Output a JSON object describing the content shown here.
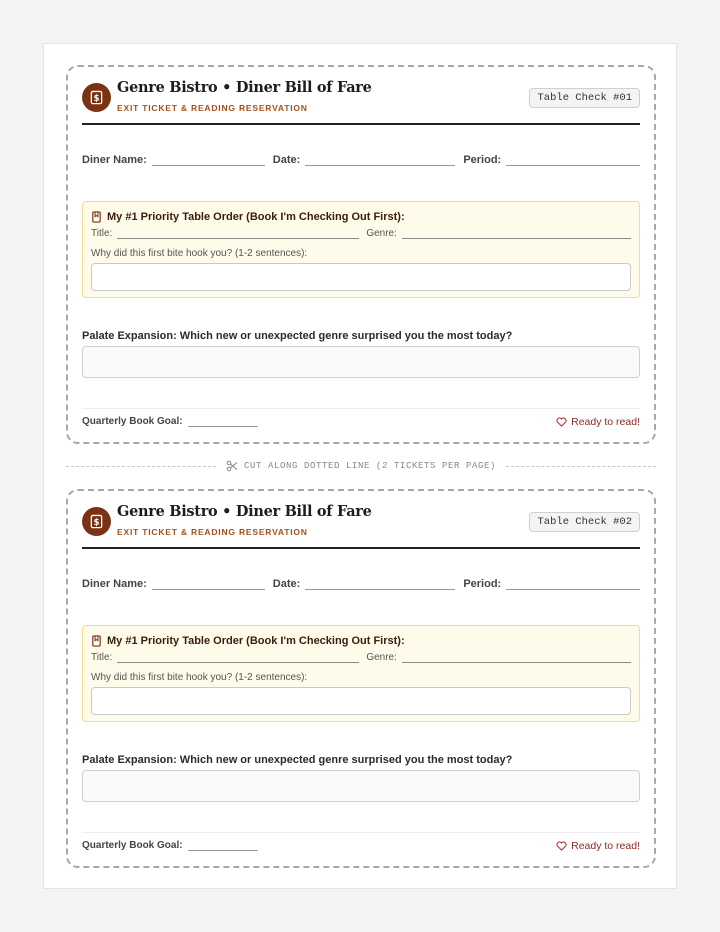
{
  "tickets": [
    {
      "title": "Genre Bistro • Diner Bill of Fare",
      "subtitle": "EXIT TICKET & READING RESERVATION",
      "badge": "Table Check #01",
      "fields": {
        "name": "Diner Name:",
        "date": "Date:",
        "period": "Period:"
      },
      "priority": {
        "heading": "My #1 Priority Table Order (Book I'm Checking Out First):",
        "title_label": "Title:",
        "genre_label": "Genre:",
        "why": "Why did this first bite hook you? (1-2 sentences):"
      },
      "question": "Palate Expansion: Which new or unexpected genre surprised you the most today?",
      "goal_label": "Quarterly Book Goal:",
      "ready": "Ready to read!"
    },
    {
      "title": "Genre Bistro • Diner Bill of Fare",
      "subtitle": "EXIT TICKET & READING RESERVATION",
      "badge": "Table Check #02",
      "fields": {
        "name": "Diner Name:",
        "date": "Date:",
        "period": "Period:"
      },
      "priority": {
        "heading": "My #1 Priority Table Order (Book I'm Checking Out First):",
        "title_label": "Title:",
        "genre_label": "Genre:",
        "why": "Why did this first bite hook you? (1-2 sentences):"
      },
      "question": "Palate Expansion: Which new or unexpected genre surprised you the most today?",
      "goal_label": "Quarterly Book Goal:",
      "ready": "Ready to read!"
    }
  ],
  "cut_line": "CUT ALONG DOTTED LINE (2 TICKETS PER PAGE)",
  "icons": {
    "logo": "menu-dollar-icon",
    "priority": "bookmark-icon",
    "ready": "heart-icon",
    "cut": "scissors-icon"
  },
  "colors": {
    "brand": "#7a3312",
    "accent": "#a4501d",
    "highlight_bg": "#fffbea",
    "highlight_border": "#f3dc88"
  }
}
